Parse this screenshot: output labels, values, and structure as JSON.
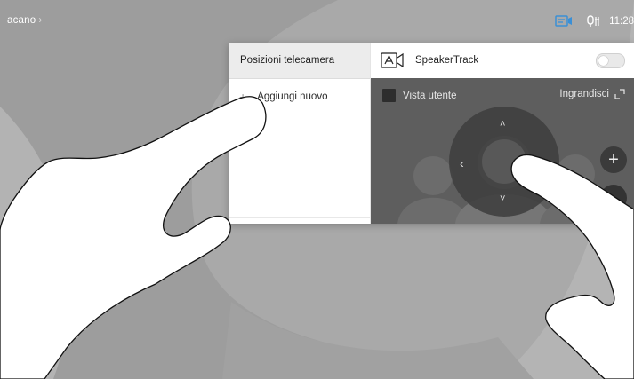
{
  "status_bar": {
    "device_name": "acano",
    "chevron": "›",
    "time": "11:28",
    "icons": [
      "screen-share-icon",
      "microphone-muted-icon"
    ]
  },
  "panel": {
    "left_title": "Posizioni telecamera",
    "add_new_label": "Aggiungi nuovo",
    "speakertrack_label": "SpeakerTrack",
    "speakertrack_on": false,
    "user_view_label": "Vista utente",
    "zoom_label": "Ingrandisci"
  },
  "dpad": {
    "up": "˄",
    "down": "˅",
    "left": "‹",
    "plus": "+"
  },
  "colors": {
    "background": "#a7a7a7",
    "camera_view": "#5f5f5f",
    "accent_icon": "#3a8fd6"
  }
}
